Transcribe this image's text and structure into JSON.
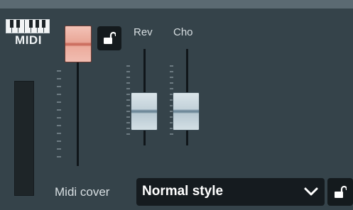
{
  "midi": {
    "label": "MIDI",
    "icon": "piano-keys-icon"
  },
  "sliders": {
    "volume": {
      "level": 0.88,
      "color": "#e9a697"
    },
    "reverb": {
      "label": "Rev",
      "level": 0.35
    },
    "chorus": {
      "label": "Cho",
      "level": 0.35
    }
  },
  "midi_cover": {
    "label": "Midi cover",
    "selected": "Normal style"
  },
  "icons": {
    "lock": "padlock-unlocked-icon",
    "dropdown": "chevron-down-icon"
  }
}
